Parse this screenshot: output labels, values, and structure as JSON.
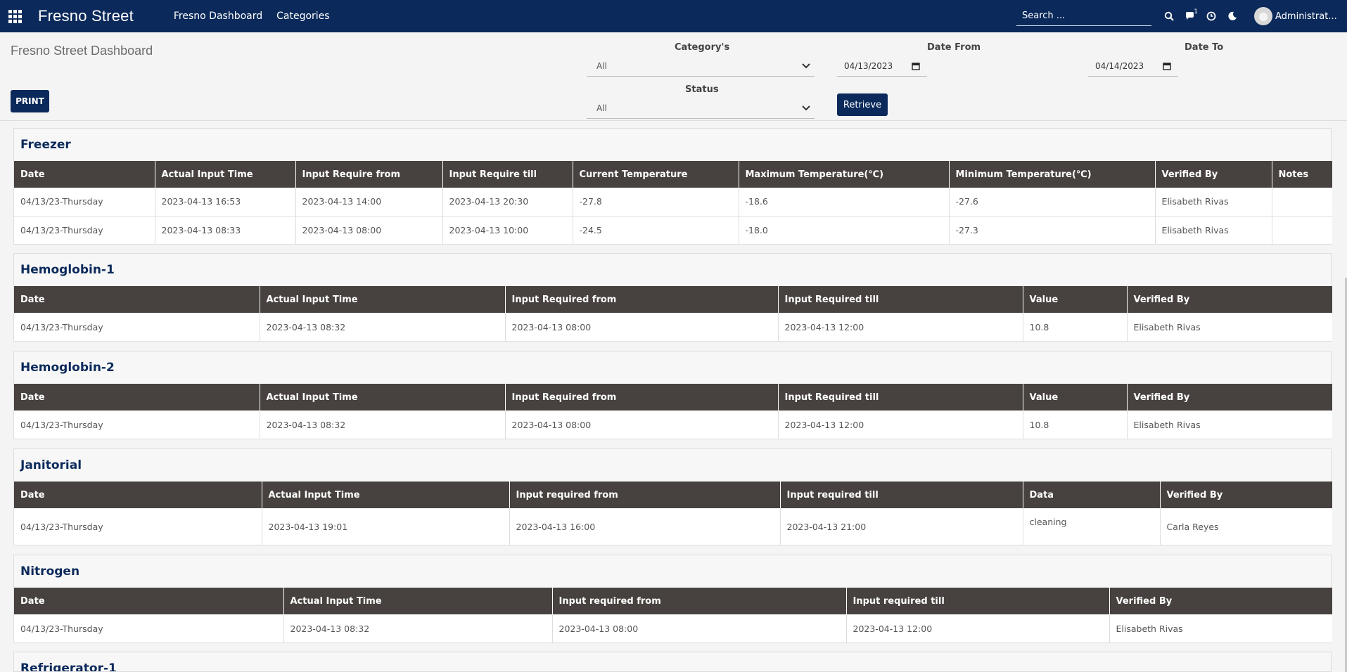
{
  "navbar": {
    "brand": "Fresno Street",
    "links": [
      "Fresno Dashboard",
      "Categories"
    ],
    "search_placeholder": "Search ...",
    "notification_count": "1",
    "user_name": "Administrat..."
  },
  "controls": {
    "page_title": "Fresno Street Dashboard",
    "print_label": "PRINT",
    "category_label": "Category's",
    "category_value": "All",
    "status_label": "Status",
    "status_value": "All",
    "date_from_label": "Date From",
    "date_from_value": "04/13/2023",
    "date_to_label": "Date To",
    "date_to_value": "04/14/2023",
    "retrieve_label": "Retrieve"
  },
  "sections": [
    {
      "title": "Freezer",
      "columns": [
        "Date",
        "Actual Input Time",
        "Input Require from",
        "Input Require till",
        "Current Temperature",
        "Maximum Temperature(℃)",
        "Minimum Temperature(℃)",
        "Verified By",
        "Notes"
      ],
      "rows": [
        [
          "04/13/23-Thursday",
          "2023-04-13 16:53",
          "2023-04-13 14:00",
          "2023-04-13 20:30",
          "-27.8",
          "-18.6",
          "-27.6",
          "Elisabeth Rivas",
          ""
        ],
        [
          "04/13/23-Thursday",
          "2023-04-13 08:33",
          "2023-04-13 08:00",
          "2023-04-13 10:00",
          "-24.5",
          "-18.0",
          "-27.3",
          "Elisabeth Rivas",
          ""
        ]
      ]
    },
    {
      "title": "Hemoglobin-1",
      "columns": [
        "Date",
        "Actual Input Time",
        "Input Required from",
        "Input Required till",
        "Value",
        "Verified By"
      ],
      "rows": [
        [
          "04/13/23-Thursday",
          "2023-04-13 08:32",
          "2023-04-13 08:00",
          "2023-04-13 12:00",
          "10.8",
          "Elisabeth Rivas"
        ]
      ]
    },
    {
      "title": "Hemoglobin-2",
      "columns": [
        "Date",
        "Actual Input Time",
        "Input Required from",
        "Input Required till",
        "Value",
        "Verified By"
      ],
      "rows": [
        [
          "04/13/23-Thursday",
          "2023-04-13 08:32",
          "2023-04-13 08:00",
          "2023-04-13 12:00",
          "10.8",
          "Elisabeth Rivas"
        ]
      ]
    },
    {
      "title": "Janitorial",
      "columns": [
        "Date",
        "Actual Input Time",
        "Input required from",
        "Input required till",
        "Data",
        "Verified By"
      ],
      "rows": [
        [
          "04/13/23-Thursday",
          "2023-04-13 19:01",
          "2023-04-13 16:00",
          "2023-04-13 21:00",
          "cleaning",
          "Carla Reyes"
        ]
      ]
    },
    {
      "title": "Nitrogen",
      "columns": [
        "Date",
        "Actual Input Time",
        "Input required from",
        "Input required till",
        "Verified By"
      ],
      "rows": [
        [
          "04/13/23-Thursday",
          "2023-04-13 08:32",
          "2023-04-13 08:00",
          "2023-04-13 12:00",
          "Elisabeth Rivas"
        ]
      ]
    },
    {
      "title": "Refrigerator-1",
      "columns": [],
      "rows": []
    }
  ]
}
